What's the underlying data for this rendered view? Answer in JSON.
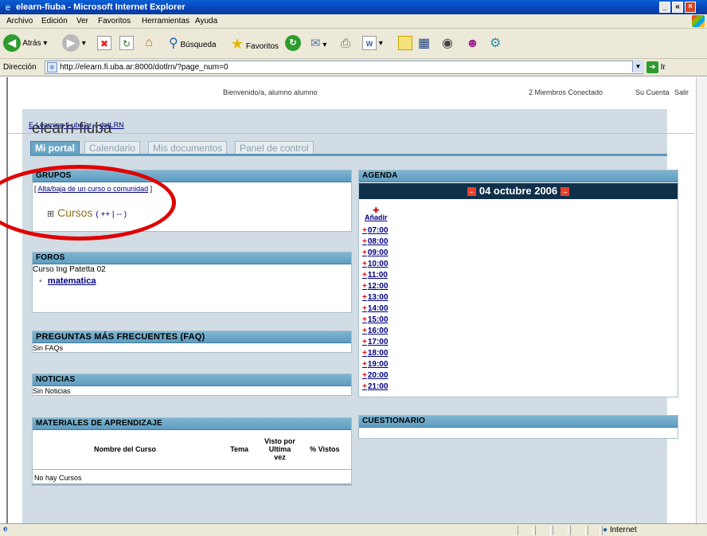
{
  "window": {
    "title": "elearn-fiuba - Microsoft Internet Explorer",
    "min": "_",
    "max": "«",
    "close": "×"
  },
  "menu": [
    "Archivo",
    "Edición",
    "Ver",
    "Favoritos",
    "Herramientas",
    "Ayuda"
  ],
  "toolbar": {
    "back": "Atrás",
    "search": "Búsqueda",
    "favorites": "Favoritos"
  },
  "address": {
    "label": "Dirección",
    "url": "http://elearn.fi.uba.ar:8000/dotlrn/?page_num=0",
    "go": "Ir"
  },
  "header": {
    "welcome": "Bienvenido/a, alumno alumno",
    "members": "2 Miembros Conectado",
    "account": "Su Cuenta",
    "logout": "Salir",
    "breadcrumb_home": "E-Learning fi.uba.ar",
    "breadcrumb_sep": "»",
    "breadcrumb_current": "dotLRN"
  },
  "site_title": "elearn-fiuba",
  "tabs": [
    "Mi portal",
    "Calendario",
    "Mis documentos",
    "Panel de control"
  ],
  "grupos": {
    "title": "GRUPOS",
    "link_open": "[",
    "link": "Alta/baja de un curso o comunidad",
    "link_close": "]",
    "expander": "⊞",
    "cursos": "Cursos",
    "controls": "( ++ | -- )"
  },
  "foros": {
    "title": "FOROS",
    "course": "Curso Ing Patetta 02",
    "item": "matematica"
  },
  "faq": {
    "title": "PREGUNTAS MÁS FRECUENTES (FAQ)",
    "text": "Sin FAQs"
  },
  "noticias": {
    "title": "NOTICIAS",
    "text": "Sin Noticias"
  },
  "materiales": {
    "title": "MATERIALES DE APRENDIZAJE",
    "columns": [
      "Nombre del Curso",
      "Tema",
      "Visto por Ultima vez",
      "% Vistos"
    ],
    "empty": "No hay Cursos"
  },
  "agenda": {
    "title": "AGENDA",
    "date": "04 octubre 2006",
    "add": "Añadir",
    "hours": [
      "07:00",
      "08:00",
      "09:00",
      "10:00",
      "11:00",
      "12:00",
      "13:00",
      "14:00",
      "15:00",
      "16:00",
      "17:00",
      "18:00",
      "19:00",
      "20:00",
      "21:00"
    ]
  },
  "cuestionario": {
    "title": "CUESTIONARIO"
  },
  "status": {
    "zone": "Internet"
  },
  "colors": {
    "portlet_header": "#5e9cc0",
    "page_bg": "#d1dce4",
    "calendar_header": "#10304a",
    "annotation": "#e00000"
  }
}
